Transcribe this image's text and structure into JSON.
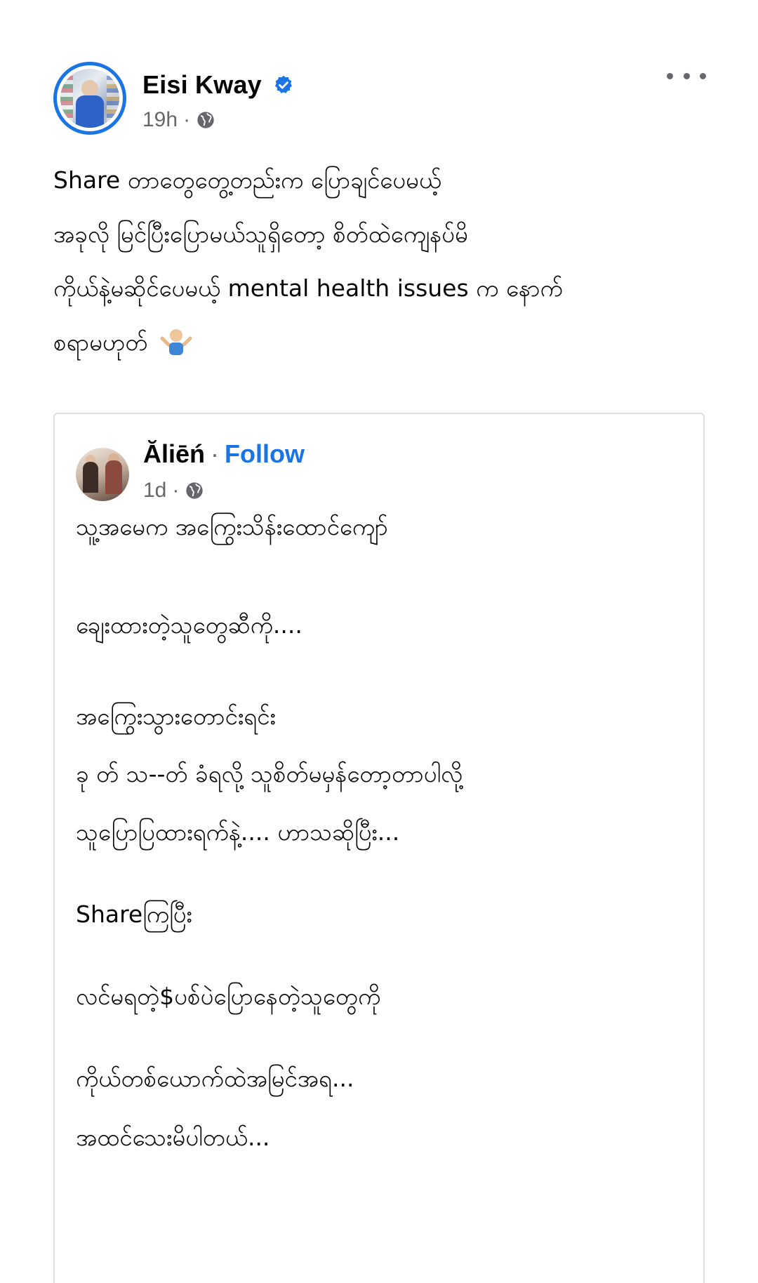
{
  "post": {
    "author": "Eisi Kway",
    "time": "19h",
    "separator": "·",
    "text_lines": [
      "Share တာတွေတွေ့တည်းက ပြောချင်ပေမယ့်",
      "အခုလို မြင်ပြီးပြောမယ်သူရှိတော့ စိတ်ထဲကျေနပ်မိ",
      "ကိုယ်နဲ့မဆိုင်ပေမယ့် mental health issues က နောက်",
      "စရာမဟုတ်"
    ],
    "emoji": "man-shrugging-emoji"
  },
  "shared": {
    "author": "Ăliēń",
    "separator": "·",
    "follow_label": "Follow",
    "time": "1d",
    "text_lines": [
      "သူ့အမေက အကြွေးသိန်းထောင်ကျော်",
      "ချေးထားတဲ့သူတွေဆီကို....",
      " အကြွေးသွားတောင်းရင်း",
      "ခု တ် သ--တ် ခံရလို့ သူစိတ်မမှန်တော့တာပါလို့",
      "သူပြောပြထားရက်နဲ့.... ဟာသဆိုပြီး...",
      "Shareကြပြီး",
      "လင်မရတဲ့$ပစ်ပဲပြောနေတဲ့သူတွေကို",
      "ကိုယ်တစ်ယောက်ထဲအမြင်အရ...",
      "အထင်သေးမိပါတယ်..."
    ]
  },
  "colors": {
    "link_blue": "#1b74e4",
    "meta_gray": "#65676b",
    "text": "#050505",
    "border": "#dddfe2"
  },
  "icons": [
    "verified-badge-icon",
    "globe-icon",
    "more-options-icon",
    "man-shrugging-emoji"
  ]
}
